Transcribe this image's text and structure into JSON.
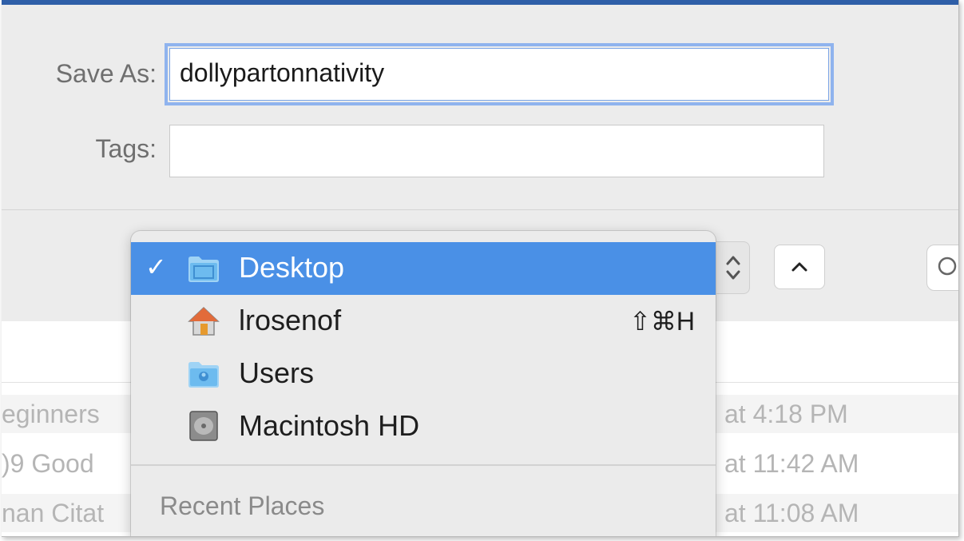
{
  "form": {
    "save_as_label": "Save As:",
    "save_as_value": "dollypartonnativity",
    "tags_label": "Tags:",
    "tags_value": ""
  },
  "location_menu": {
    "items": [
      {
        "label": "Desktop",
        "selected": true,
        "icon": "folder-icon",
        "shortcut": ""
      },
      {
        "label": "lrosenof",
        "selected": false,
        "icon": "home-icon",
        "shortcut": "⇧⌘H"
      },
      {
        "label": "Users",
        "selected": false,
        "icon": "users-folder-icon",
        "shortcut": ""
      },
      {
        "label": "Macintosh HD",
        "selected": false,
        "icon": "hard-drive-icon",
        "shortcut": ""
      }
    ],
    "check_mark": "✓",
    "section_header": "Recent Places"
  },
  "stepper_glyph": "⌃⌄",
  "file_list": {
    "rows": [
      {
        "name": "eginners",
        "date": "at 4:18 PM"
      },
      {
        "name": ")9 Good",
        "date": "at 11:42 AM"
      },
      {
        "name": "nan Citat",
        "date": "at 11:08 AM"
      }
    ]
  },
  "colors": {
    "accent": "#4a90e6",
    "focus_ring": "#8fb3ee",
    "window_bg": "#ececec"
  }
}
